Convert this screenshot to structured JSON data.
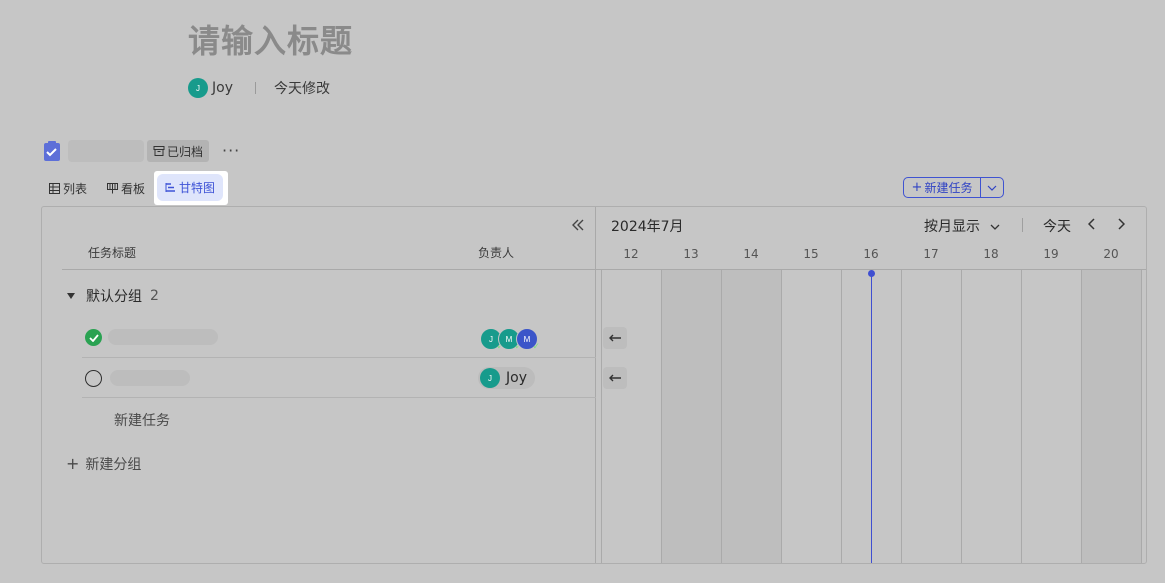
{
  "doc": {
    "title": "请输入标题",
    "author": {
      "name": "Joy",
      "initial": "J"
    },
    "modified": "今天修改"
  },
  "project": {
    "archived_label": "已归档",
    "more": "···"
  },
  "tabs": [
    {
      "label": "列表",
      "icon": "table-icon"
    },
    {
      "label": "看板",
      "icon": "board-icon"
    },
    {
      "label": "甘特图",
      "icon": "gantt-icon",
      "active": true
    }
  ],
  "toolbar": {
    "new_task_label": "新建任务"
  },
  "table": {
    "col_title": "任务标题",
    "col_assignee": "负责人",
    "group": {
      "name": "默认分组",
      "count": "2"
    },
    "tasks": [
      {
        "done": true,
        "assignees": [
          "J",
          "M",
          "M"
        ]
      },
      {
        "done": false,
        "assignee": {
          "initial": "J",
          "name": "Joy"
        }
      }
    ],
    "add_task": "新建任务",
    "add_group": "新建分组"
  },
  "gantt": {
    "month": "2024年7月",
    "view_mode": "按月显示",
    "today": "今天",
    "days": [
      "12",
      "13",
      "14",
      "15",
      "16",
      "17",
      "18",
      "19",
      "20"
    ],
    "current_day": "16"
  },
  "colors": {
    "accent": "#3f53d1",
    "done_green": "#2aa252",
    "avatar_teal": "#179b8c",
    "avatar_blue": "#3b55c9"
  }
}
